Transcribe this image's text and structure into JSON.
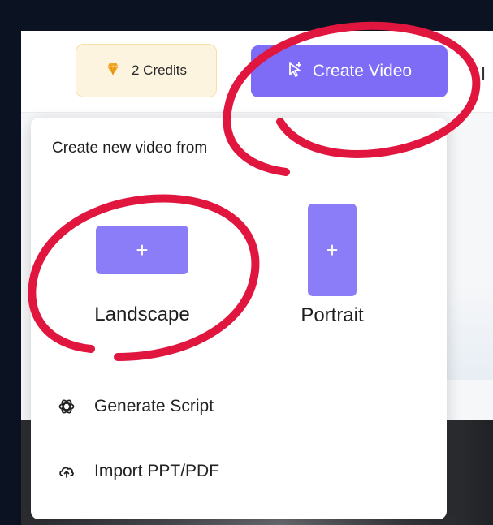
{
  "topbar": {
    "credits_label": "2 Credits",
    "create_video_label": "Create Video",
    "edge_glyph": "I"
  },
  "menu": {
    "title": "Create new video from",
    "options": [
      {
        "label": "Landscape",
        "icon": "plus-icon"
      },
      {
        "label": "Portrait",
        "icon": "plus-icon"
      }
    ],
    "actions": [
      {
        "label": "Generate Script",
        "icon": "openai-icon"
      },
      {
        "label": "Import PPT/PDF",
        "icon": "cloud-upload-icon"
      }
    ]
  },
  "colors": {
    "accent": "#7e6cf7",
    "thumb": "#8b7cf8",
    "credits_bg": "#fdf4df",
    "gem": "#f5a623",
    "annotation": "#e0163f",
    "backdrop": "#0b1222"
  }
}
